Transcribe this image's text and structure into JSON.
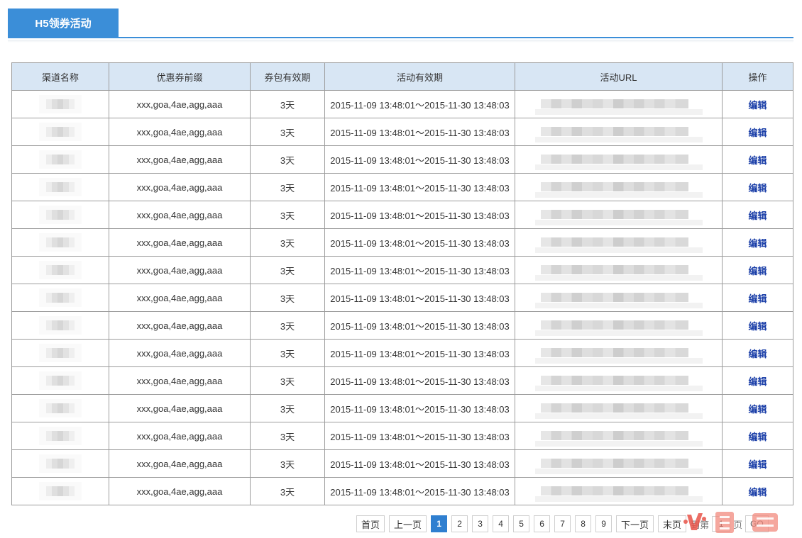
{
  "header": {
    "tab_title": "H5领券活动"
  },
  "table": {
    "columns": [
      "渠道名称",
      "优惠券前缀",
      "券包有效期",
      "活动有效期",
      "活动URL",
      "操作"
    ],
    "rows": [
      {
        "prefix": "xxx,goa,4ae,agg,aaa",
        "validity": "3天",
        "period": "2015-11-09 13:48:01～2015-11-30 13:48:03",
        "action": "编辑"
      },
      {
        "prefix": "xxx,goa,4ae,agg,aaa",
        "validity": "3天",
        "period": "2015-11-09 13:48:01～2015-11-30 13:48:03",
        "action": "编辑"
      },
      {
        "prefix": "xxx,goa,4ae,agg,aaa",
        "validity": "3天",
        "period": "2015-11-09 13:48:01～2015-11-30 13:48:03",
        "action": "编辑"
      },
      {
        "prefix": "xxx,goa,4ae,agg,aaa",
        "validity": "3天",
        "period": "2015-11-09 13:48:01～2015-11-30 13:48:03",
        "action": "编辑"
      },
      {
        "prefix": "xxx,goa,4ae,agg,aaa",
        "validity": "3天",
        "period": "2015-11-09 13:48:01～2015-11-30 13:48:03",
        "action": "编辑"
      },
      {
        "prefix": "xxx,goa,4ae,agg,aaa",
        "validity": "3天",
        "period": "2015-11-09 13:48:01～2015-11-30 13:48:03",
        "action": "编辑"
      },
      {
        "prefix": "xxx,goa,4ae,agg,aaa",
        "validity": "3天",
        "period": "2015-11-09 13:48:01～2015-11-30 13:48:03",
        "action": "编辑"
      },
      {
        "prefix": "xxx,goa,4ae,agg,aaa",
        "validity": "3天",
        "period": "2015-11-09 13:48:01～2015-11-30 13:48:03",
        "action": "编辑"
      },
      {
        "prefix": "xxx,goa,4ae,agg,aaa",
        "validity": "3天",
        "period": "2015-11-09 13:48:01～2015-11-30 13:48:03",
        "action": "编辑"
      },
      {
        "prefix": "xxx,goa,4ae,agg,aaa",
        "validity": "3天",
        "period": "2015-11-09 13:48:01～2015-11-30 13:48:03",
        "action": "编辑"
      },
      {
        "prefix": "xxx,goa,4ae,agg,aaa",
        "validity": "3天",
        "period": "2015-11-09 13:48:01～2015-11-30 13:48:03",
        "action": "编辑"
      },
      {
        "prefix": "xxx,goa,4ae,agg,aaa",
        "validity": "3天",
        "period": "2015-11-09 13:48:01～2015-11-30 13:48:03",
        "action": "编辑"
      },
      {
        "prefix": "xxx,goa,4ae,agg,aaa",
        "validity": "3天",
        "period": "2015-11-09 13:48:01～2015-11-30 13:48:03",
        "action": "编辑"
      },
      {
        "prefix": "xxx,goa,4ae,agg,aaa",
        "validity": "3天",
        "period": "2015-11-09 13:48:01～2015-11-30 13:48:03",
        "action": "编辑"
      },
      {
        "prefix": "xxx,goa,4ae,agg,aaa",
        "validity": "3天",
        "period": "2015-11-09 13:48:01～2015-11-30 13:48:03",
        "action": "编辑"
      }
    ]
  },
  "pager": {
    "first": "首页",
    "prev": "上一页",
    "pages": [
      "1",
      "2",
      "3",
      "4",
      "5",
      "6",
      "7",
      "8",
      "9"
    ],
    "current": "1",
    "next": "下一页",
    "last": "末页",
    "goto_prefix": "到第",
    "goto_value": "1",
    "goto_suffix": "页",
    "go": "GO"
  },
  "colors": {
    "accent": "#3b8ed8",
    "header_bg": "#d8e6f4",
    "link": "#1b3fa8",
    "current_page": "#2f7fd0"
  }
}
